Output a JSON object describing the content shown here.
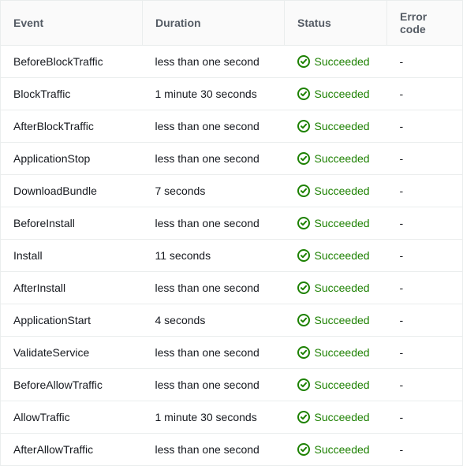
{
  "table": {
    "headers": {
      "event": "Event",
      "duration": "Duration",
      "status": "Status",
      "error_code": "Error code"
    },
    "status_label_succeeded": "Succeeded",
    "rows": [
      {
        "event": "BeforeBlockTraffic",
        "duration": "less than one second",
        "status": "Succeeded",
        "error_code": "-"
      },
      {
        "event": "BlockTraffic",
        "duration": "1 minute 30 seconds",
        "status": "Succeeded",
        "error_code": "-"
      },
      {
        "event": "AfterBlockTraffic",
        "duration": "less than one second",
        "status": "Succeeded",
        "error_code": "-"
      },
      {
        "event": "ApplicationStop",
        "duration": "less than one second",
        "status": "Succeeded",
        "error_code": "-"
      },
      {
        "event": "DownloadBundle",
        "duration": "7 seconds",
        "status": "Succeeded",
        "error_code": "-"
      },
      {
        "event": "BeforeInstall",
        "duration": "less than one second",
        "status": "Succeeded",
        "error_code": "-"
      },
      {
        "event": "Install",
        "duration": "11 seconds",
        "status": "Succeeded",
        "error_code": "-"
      },
      {
        "event": "AfterInstall",
        "duration": "less than one second",
        "status": "Succeeded",
        "error_code": "-"
      },
      {
        "event": "ApplicationStart",
        "duration": "4 seconds",
        "status": "Succeeded",
        "error_code": "-"
      },
      {
        "event": "ValidateService",
        "duration": "less than one second",
        "status": "Succeeded",
        "error_code": "-"
      },
      {
        "event": "BeforeAllowTraffic",
        "duration": "less than one second",
        "status": "Succeeded",
        "error_code": "-"
      },
      {
        "event": "AllowTraffic",
        "duration": "1 minute 30 seconds",
        "status": "Succeeded",
        "error_code": "-"
      },
      {
        "event": "AfterAllowTraffic",
        "duration": "less than one second",
        "status": "Succeeded",
        "error_code": "-"
      }
    ]
  }
}
